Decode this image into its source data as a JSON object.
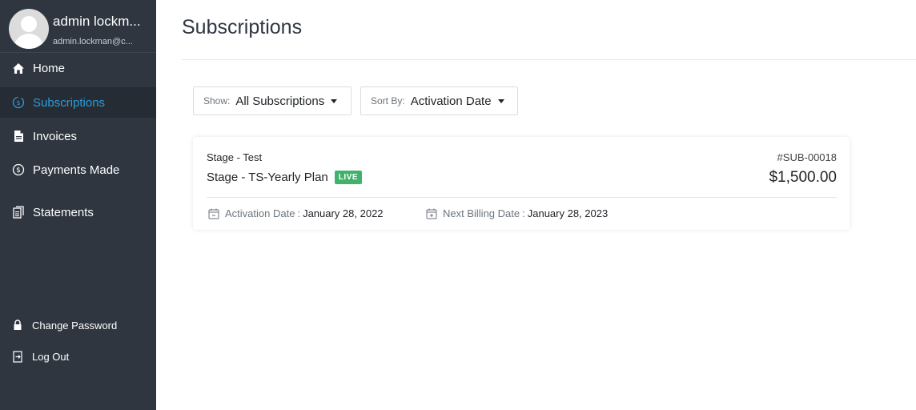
{
  "profile": {
    "name": "admin lockm...",
    "email": "admin.lockman@c..."
  },
  "nav": {
    "items": [
      {
        "label": "Home",
        "icon": "home-icon"
      },
      {
        "label": "Subscriptions",
        "icon": "subscriptions-icon",
        "active": true
      },
      {
        "label": "Invoices",
        "icon": "document-icon"
      },
      {
        "label": "Payments Made",
        "icon": "dollar-circle-icon"
      },
      {
        "label": "Statements",
        "icon": "statement-icon"
      }
    ],
    "bottom": [
      {
        "label": "Change Password",
        "icon": "lock-icon"
      },
      {
        "label": "Log Out",
        "icon": "logout-icon"
      }
    ]
  },
  "main": {
    "title": "Subscriptions",
    "filters": {
      "show_label": "Show:",
      "show_value": "All Subscriptions",
      "sort_label": "Sort By:",
      "sort_value": "Activation Date"
    },
    "subscription": {
      "organization": "Stage - Test",
      "id": "#SUB-00018",
      "plan": "Stage - TS-Yearly Plan",
      "status": "LIVE",
      "amount": "$1,500.00",
      "activation_label": "Activation Date",
      "activation_date": "January 28, 2022",
      "next_billing_label": "Next Billing Date",
      "next_billing_date": "January 28, 2023"
    }
  },
  "colors": {
    "sidebar_bg": "#2f3640",
    "active_bg": "#262c34",
    "active_text": "#2b9bdc",
    "badge_live": "#3fb26b"
  }
}
